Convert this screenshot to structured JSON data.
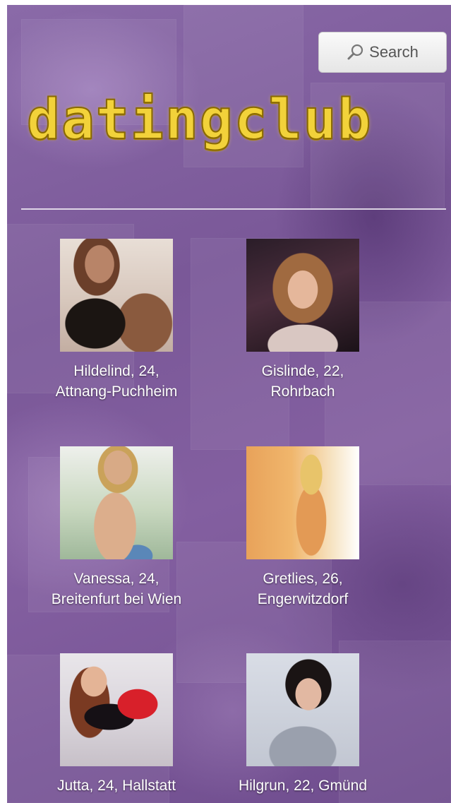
{
  "header": {
    "search_label": "Search",
    "search_icon": "magnifier-icon",
    "logo_text": "datingclub",
    "logo_color": "#f2d23a"
  },
  "profiles": [
    {
      "line1": "Hildelind, 24,",
      "line2": "Attnang-Puchheim"
    },
    {
      "line1": "Gislinde, 22,",
      "line2": "Rohrbach"
    },
    {
      "line1": "Vanessa, 24,",
      "line2": "Breitenfurt bei Wien"
    },
    {
      "line1": "Gretlies, 26,",
      "line2": "Engerwitzdorf"
    },
    {
      "line1": "Jutta, 24, Hallstatt",
      "line2": ""
    },
    {
      "line1": "Hilgrun, 22, Gmünd",
      "line2": ""
    }
  ],
  "colors": {
    "background": "#7a5898",
    "caption_text": "#ffffff",
    "divider": "#ffffff"
  }
}
